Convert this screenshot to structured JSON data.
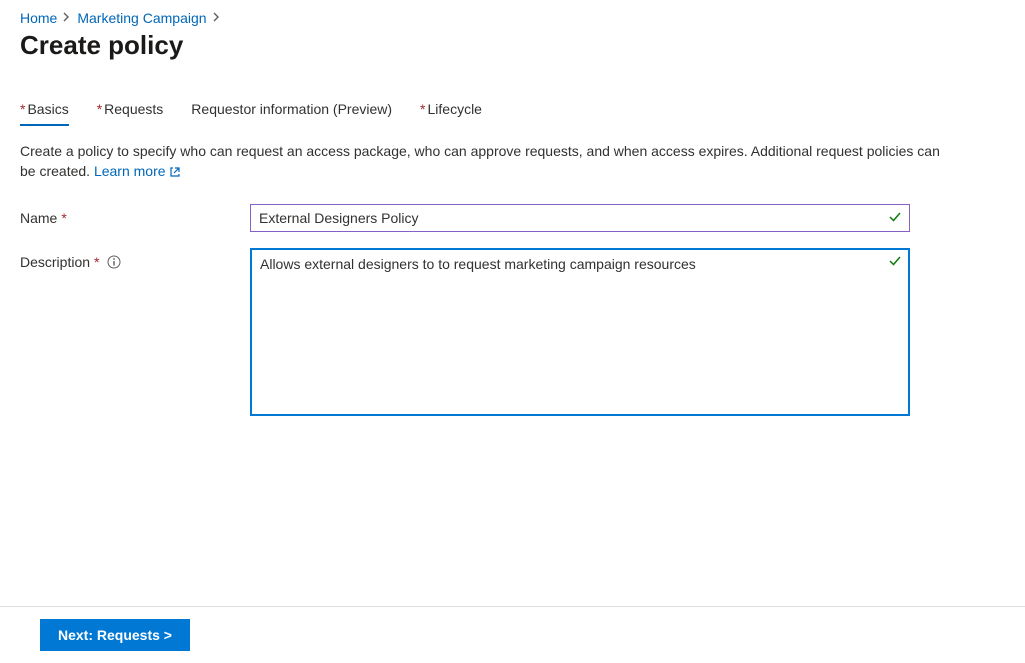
{
  "breadcrumb": {
    "items": [
      {
        "label": "Home"
      },
      {
        "label": "Marketing Campaign"
      }
    ]
  },
  "page_title": "Create policy",
  "tabs": [
    {
      "label": "Basics",
      "required": true,
      "active": true
    },
    {
      "label": "Requests",
      "required": true,
      "active": false
    },
    {
      "label": "Requestor information (Preview)",
      "required": false,
      "active": false
    },
    {
      "label": "Lifecycle",
      "required": true,
      "active": false
    }
  ],
  "intro": {
    "text": "Create a policy to specify who can request an access package, who can approve requests, and when access expires. Additional request policies can be created. ",
    "learn_more": "Learn more"
  },
  "form": {
    "name": {
      "label": "Name",
      "value": "External Designers Policy"
    },
    "description": {
      "label": "Description",
      "value": "Allows external designers to to request marketing campaign resources"
    }
  },
  "footer": {
    "next_label": "Next: Requests >"
  }
}
